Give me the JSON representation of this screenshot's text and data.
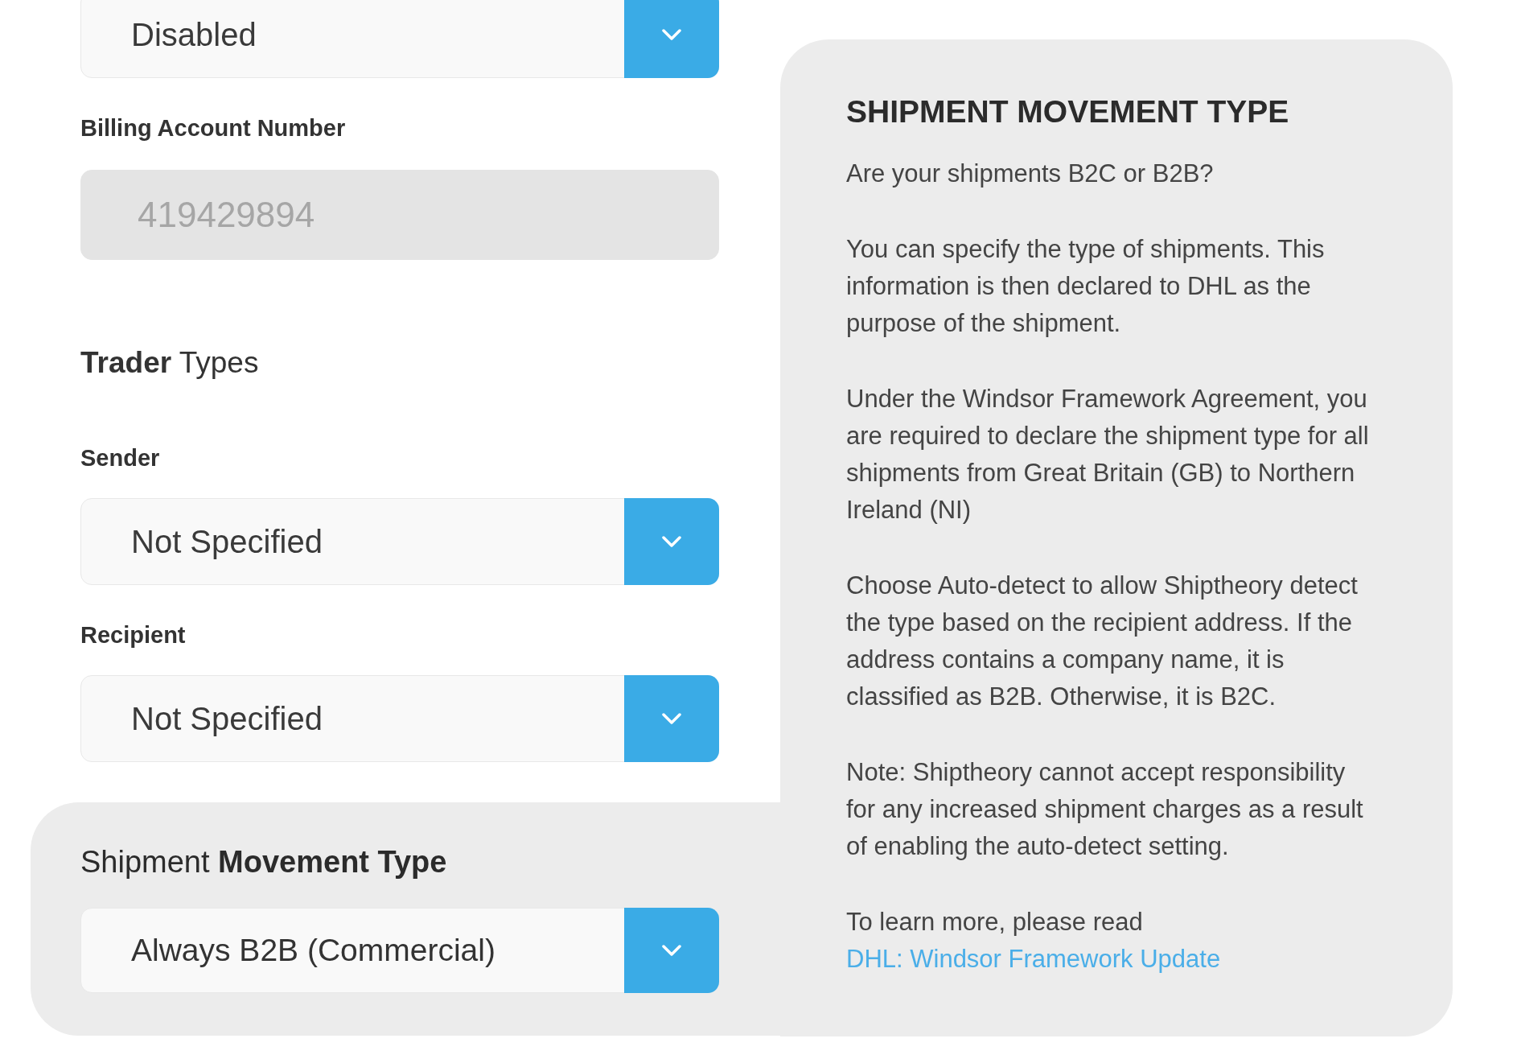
{
  "background_form": {
    "top_select": {
      "value": "Disabled"
    },
    "billing_account_number": {
      "label": "Billing Account Number",
      "value": "419429894",
      "disabled": true
    },
    "trader_types": {
      "heading": "**Trader** Types",
      "fields": [
        {
          "label": "Sender",
          "value": "Not Specified"
        },
        {
          "label": "Recipient",
          "value": "Not Specified"
        }
      ]
    }
  },
  "shipment_movement_type": {
    "label": "Shipment **Movement Type**",
    "value": "Always B2B (Commercial)"
  },
  "help_panel": {
    "title": "SHIPMENT MOVEMENT TYPE",
    "paragraphs": [
      {
        "text": "Are your shipments B2C or B2B?"
      },
      {
        "text": "You can specify the type of shipments. This information is then declared to DHL as the purpose of the shipment."
      },
      {
        "text": "Under the Windsor Framework Agreement, you are required to declare the shipment type for all shipments from Great Britain (GB) to Northern Ireland (NI)"
      },
      {
        "text": "Choose Auto-detect to allow Shiptheory detect the type based on the recipient address. If the address contains a company name, it is classified as B2B. Otherwise, it is B2C."
      },
      {
        "text": "Note: Shiptheory cannot accept responsibility for any increased shipment charges as a result of enabling the auto-detect setting."
      },
      {
        "text": "To learn more, please read",
        "link": "DHL: Windsor Framework Update"
      }
    ]
  }
}
